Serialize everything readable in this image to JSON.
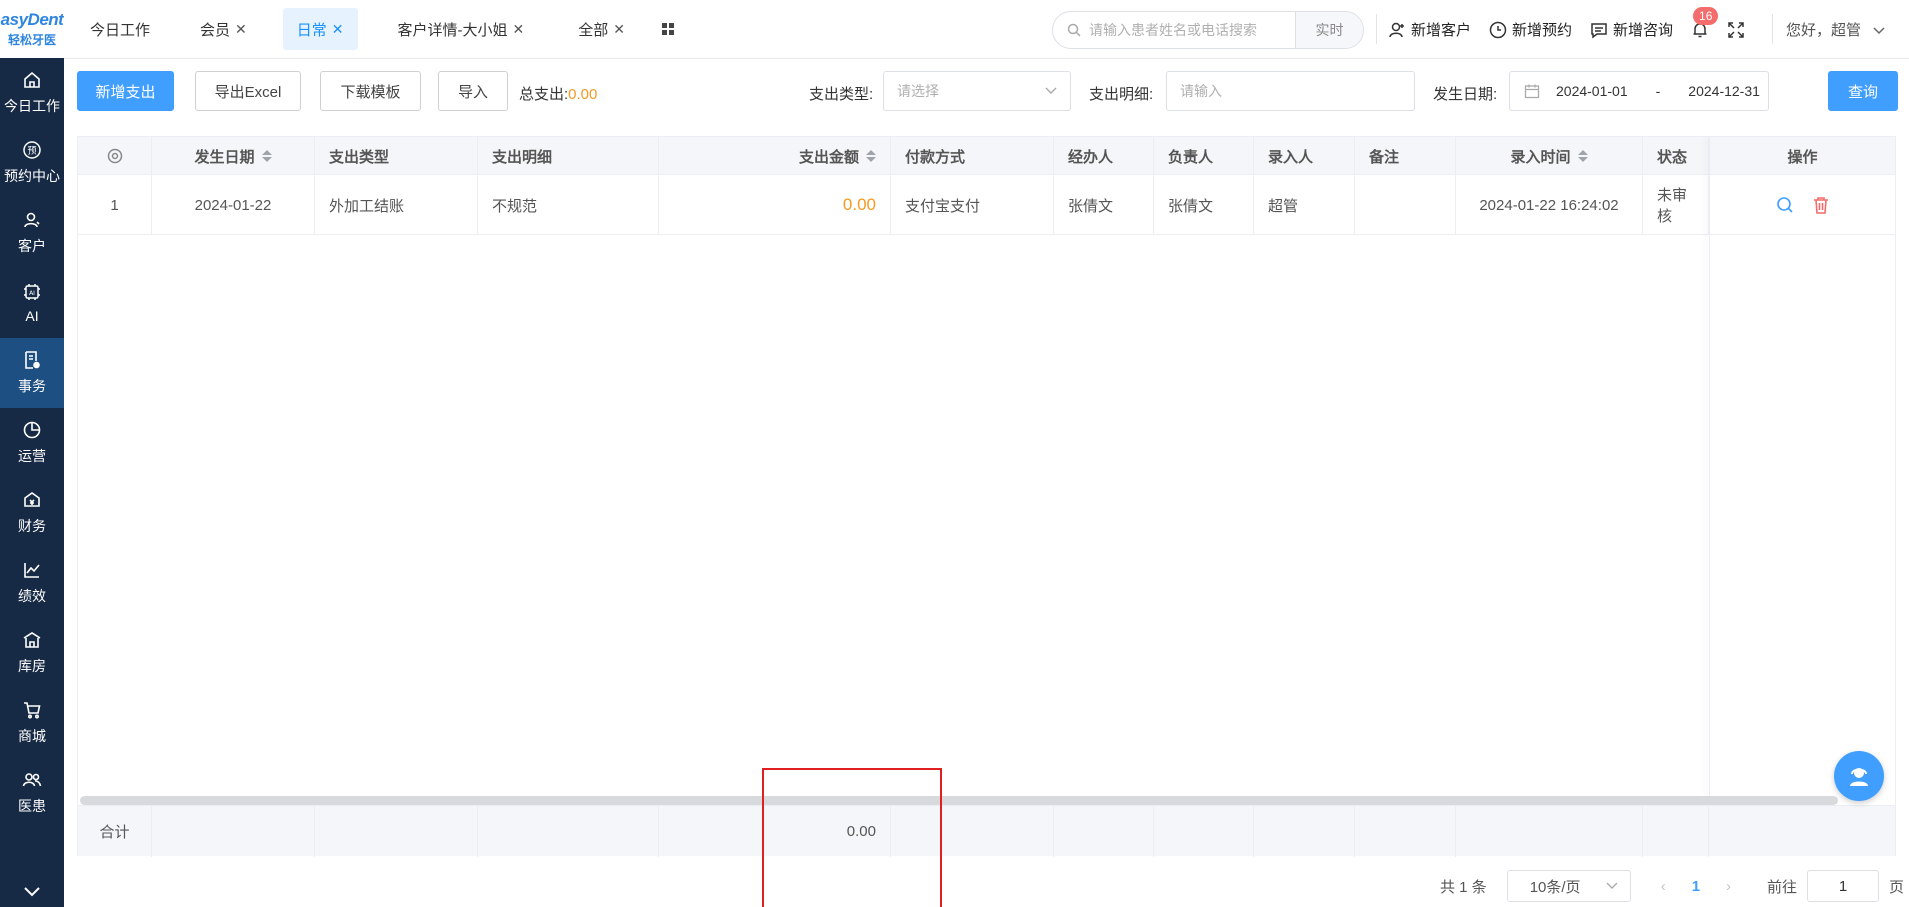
{
  "logo": {
    "line1": "asyDent",
    "line2": "轻松牙医"
  },
  "sidebar": {
    "items": [
      {
        "label": "今日工作",
        "icon": "home-icon"
      },
      {
        "label": "预约中心",
        "icon": "appointment-icon"
      },
      {
        "label": "客户",
        "icon": "user-icon"
      },
      {
        "label": "AI",
        "icon": "ai-icon"
      },
      {
        "label": "事务",
        "icon": "document-icon",
        "active": true
      },
      {
        "label": "运营",
        "icon": "pie-chart-icon"
      },
      {
        "label": "财务",
        "icon": "finance-icon"
      },
      {
        "label": "绩效",
        "icon": "line-chart-icon"
      },
      {
        "label": "库房",
        "icon": "warehouse-icon"
      },
      {
        "label": "商城",
        "icon": "cart-icon"
      },
      {
        "label": "医患",
        "icon": "people-icon"
      }
    ]
  },
  "tabs": [
    {
      "label": "今日工作",
      "closable": false
    },
    {
      "label": "会员",
      "closable": true
    },
    {
      "label": "日常",
      "closable": true,
      "active": true
    },
    {
      "label": "客户详情-大小姐",
      "closable": true
    },
    {
      "label": "全部",
      "closable": true
    }
  ],
  "search": {
    "placeholder": "请输入患者姓名或电话搜索",
    "realtime_label": "实时"
  },
  "top_actions": {
    "new_customer": "新增客户",
    "new_appointment": "新增预约",
    "new_consult": "新增咨询",
    "notification_count": "16",
    "greeting": "您好，超管"
  },
  "toolbar": {
    "add_expense": "新增支出",
    "export_excel": "导出Excel",
    "download_template": "下载模板",
    "import": "导入",
    "total_label": "总支出:",
    "total_value": "0.00",
    "type_label": "支出类型:",
    "type_placeholder": "请选择",
    "detail_label": "支出明细:",
    "detail_placeholder": "请输入",
    "date_label": "发生日期:",
    "date_start": "2024-01-01",
    "date_sep": "-",
    "date_end": "2024-12-31",
    "query": "查询"
  },
  "table": {
    "columns": [
      "发生日期",
      "支出类型",
      "支出明细",
      "支出金额",
      "付款方式",
      "经办人",
      "负责人",
      "录入人",
      "备注",
      "录入时间",
      "状态",
      "操作"
    ],
    "rows": [
      {
        "index": "1",
        "date": "2024-01-22",
        "type": "外加工结账",
        "detail": "不规范",
        "amount": "0.00",
        "payment": "支付宝支付",
        "handler": "张倩文",
        "owner": "张倩文",
        "entered_by": "超管",
        "note": "",
        "entered_at": "2024-01-22 16:24:02",
        "status": "未审核"
      }
    ],
    "footer": {
      "label": "合计",
      "amount": "0.00"
    }
  },
  "pagination": {
    "total_text": "共 1 条",
    "page_size": "10条/页",
    "current_page": "1",
    "goto_label": "前往",
    "goto_value": "1",
    "page_suffix": "页"
  },
  "colors": {
    "primary": "#409eff",
    "sidebar": "#172a45",
    "accent_orange": "#f59a23",
    "danger": "#f56c6c"
  }
}
